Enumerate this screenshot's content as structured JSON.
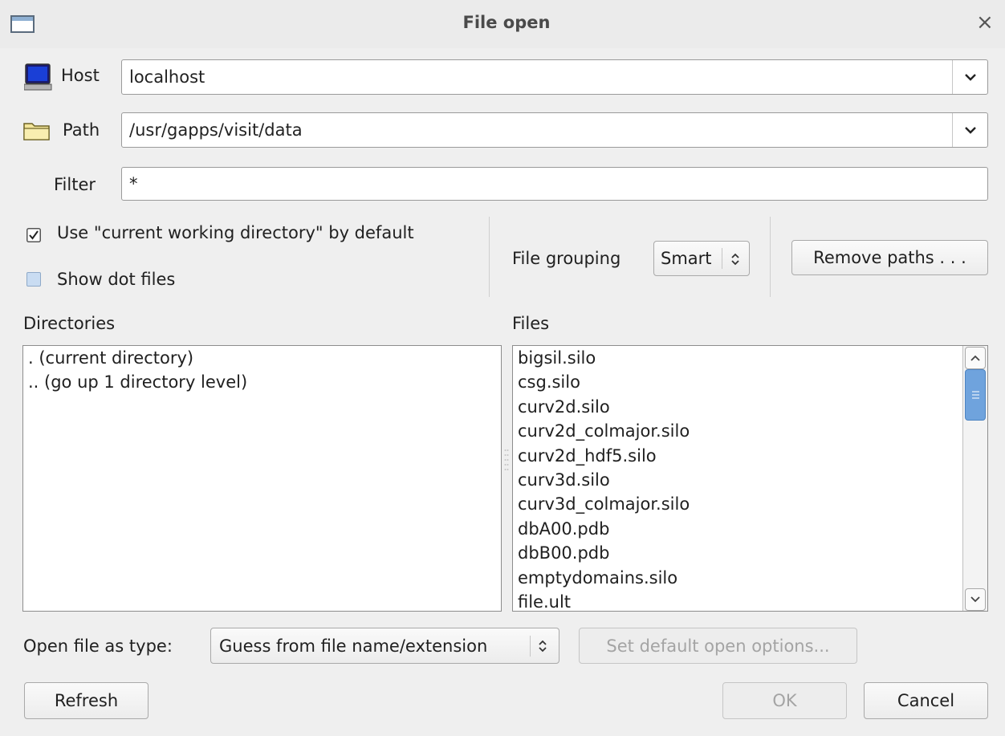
{
  "window": {
    "title": "File open"
  },
  "host": {
    "label": "Host",
    "value": "localhost"
  },
  "path": {
    "label": "Path",
    "value": "/usr/gapps/visit/data"
  },
  "filter": {
    "label": "Filter",
    "value": "*"
  },
  "options": {
    "use_cwd": {
      "label": "Use \"current working directory\" by default",
      "checked": true
    },
    "show_dot_files": {
      "label": "Show dot files",
      "checked": false
    }
  },
  "file_grouping": {
    "label": "File grouping",
    "value": "Smart"
  },
  "remove_paths_label": "Remove paths . . .",
  "directories": {
    "header": "Directories",
    "items": [
      ". (current directory)",
      ".. (go up 1 directory level)"
    ]
  },
  "files": {
    "header": "Files",
    "items": [
      "bigsil.silo",
      "csg.silo",
      "curv2d.silo",
      "curv2d_colmajor.silo",
      "curv2d_hdf5.silo",
      "curv3d.silo",
      "curv3d_colmajor.silo",
      "dbA00.pdb",
      "dbB00.pdb",
      "emptydomains.silo",
      "file.ult"
    ]
  },
  "open_as": {
    "label": "Open file as type:",
    "value": "Guess from file name/extension"
  },
  "set_default_label": "Set default open options...",
  "buttons": {
    "refresh": "Refresh",
    "ok": "OK",
    "cancel": "Cancel"
  },
  "colors": {
    "accent": "#4a90d9",
    "scroll_thumb": "#6fa3dd",
    "checkbox_unchecked": "#c9dcf2"
  }
}
